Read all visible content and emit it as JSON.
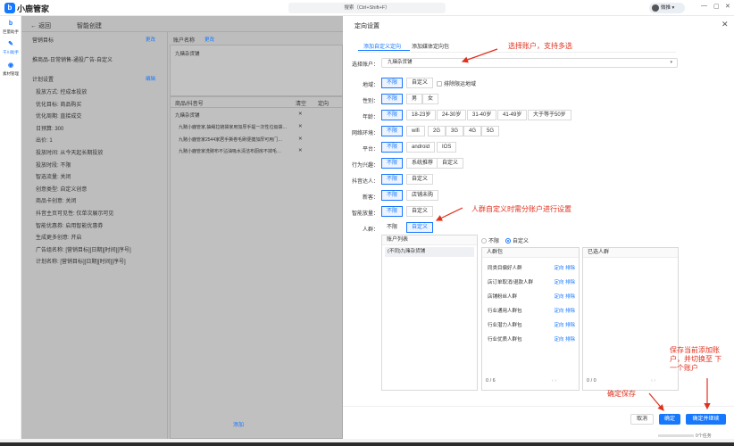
{
  "app": {
    "name": "小鹿管家",
    "logo_letter": "b"
  },
  "search": {
    "placeholder": "搜索（Ctrl+Shift+F）"
  },
  "user": {
    "name": "微推"
  },
  "window": {
    "min": "—",
    "restore": "▢",
    "close": "✕"
  },
  "nav": [
    {
      "label": "巨量助手",
      "icon": "b"
    },
    {
      "label": "千川助手",
      "icon": "✎"
    },
    {
      "label": "素材管理",
      "icon": "◉"
    }
  ],
  "bg": {
    "back": "← 返回",
    "title": "智能创建",
    "marketing_goal_label": "营销目标",
    "marketing_goal_edit": "更改",
    "marketing_goal_value": "推商品-日常销售-通投广告-自定义",
    "account_name_label": "账户名称",
    "account_name_edit": "更改",
    "account_name_value": "九赌杂货铺",
    "plan_settings_label": "计划设置",
    "plan_settings_edit": "编辑",
    "plan_lines": [
      "投放方式: 控成本投放",
      "优化目标: 商品购买",
      "优化周期: 直接成交",
      "日预算: 300",
      "出价: 1",
      "投放时间: 从今天起长期投放",
      "投放时段: 不限",
      "智选流量: 关闭",
      "创意类型: 自定义创意",
      "商品卡创意: 关闭",
      "抖音主页可见性: 仅单次展示可见",
      "智能优惠券: 启用智能优惠券",
      "生成更多创意: 开启",
      "广告组名称: [营销目标][日期][时间][序号]",
      "计划名称: [营销目标][日期][时间][序号]"
    ],
    "col_product": "商品/抖音号",
    "col_clear": "清空",
    "col_target": "定向",
    "product_group": "九赌杂货铺",
    "product_items": [
      "九赌小鹿管家,抽绳拉链袋家用加厚手提一次性垃圾袋…",
      "九赌小鹿管家2544家居手撕卷毛刷便捷加厚可用门…",
      "九赌小鹿管家洗碗布不沾油吸水清洁布厨房不掉毛…"
    ],
    "remove_icon": "✕",
    "add": "添加"
  },
  "drawer": {
    "title": "定向设置",
    "close": "✕",
    "tabs": [
      "添加自定义定向",
      "添加媒体定向包"
    ],
    "account_label": "选择账户：",
    "account_value": "九赌杂货铺",
    "select_arrow": "▾",
    "rows": [
      {
        "label": "地域：",
        "options": [
          "不限",
          "自定义"
        ],
        "selected": 0,
        "extra": "排除限运地域"
      },
      {
        "label": "性别：",
        "options": [
          "不限",
          "男",
          "女"
        ],
        "selected": 0
      },
      {
        "label": "年龄：",
        "options": [
          "不限",
          "18-23岁",
          "24-30岁",
          "31-40岁",
          "41-49岁",
          "大于等于50岁"
        ],
        "selected": 0
      },
      {
        "label": "网络环境：",
        "options": [
          "不限",
          "wifi",
          "2G",
          "3G",
          "4G",
          "5G"
        ],
        "selected": 0
      },
      {
        "label": "平台：",
        "options": [
          "不限",
          "android",
          "IOS"
        ],
        "selected": 0
      },
      {
        "label": "行为兴趣：",
        "options": [
          "不限",
          "系统推荐",
          "自定义"
        ],
        "selected": 0
      },
      {
        "label": "抖音达人：",
        "options": [
          "不限",
          "自定义"
        ],
        "selected": 0
      },
      {
        "label": "新客：",
        "options": [
          "不限",
          "店铺未购"
        ],
        "selected": 0
      },
      {
        "label": "智能放量：",
        "options": [
          "不限",
          "自定义"
        ],
        "selected": 0
      },
      {
        "label": "人群：",
        "options": [
          "不限",
          "自定义"
        ],
        "selected": 1
      }
    ],
    "account_list_title": "账户列表",
    "account_list_item": "(不同)九赌杂货铺",
    "radio_unlimited": "不限",
    "radio_custom": "自定义",
    "crowd_pack_title": "人群包",
    "crowds": [
      "同类目偏好人群",
      "店订单取消/退款人群",
      "店铺粉丝人群",
      "行业通用人群包",
      "行业潜力人群包",
      "行业优质人群包"
    ],
    "crowd_actions": "定向 排除",
    "crowd_count": "0 / 6",
    "selected_title": "已选人群",
    "selected_count": "0 / 0",
    "pager": "‹   ›",
    "btn_cancel": "取消",
    "btn_ok": "确定",
    "btn_ok_next": "确定并继续",
    "progress": "0个任务"
  },
  "annotations": {
    "a1": "选择账户，支持多选",
    "a2": "人群自定义时需分账户进行设置",
    "a3": "保存当前添加账户，并切换至 下一个账户",
    "a4": "确定保存"
  },
  "colors": {
    "accent": "#1677ff",
    "annotation": "#e0301e",
    "overlay": "#bdbdbd"
  }
}
